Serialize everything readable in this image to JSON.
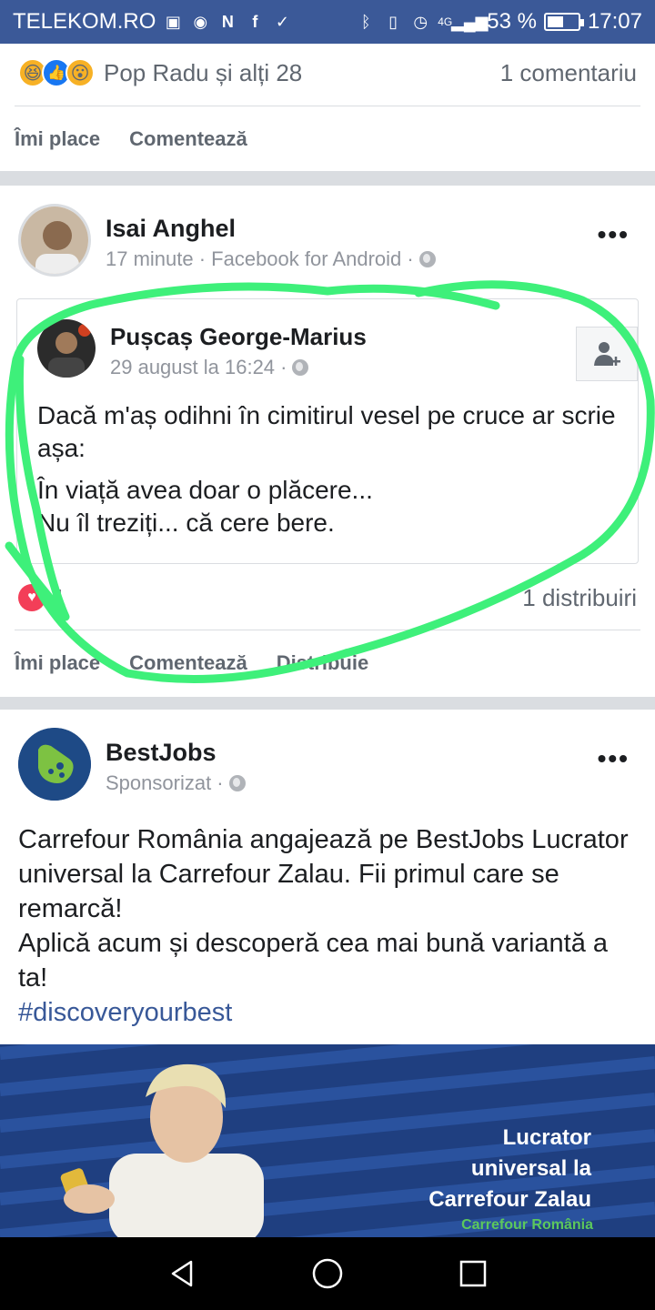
{
  "status_bar": {
    "carrier": "TELEKOM.RO",
    "network": "4G",
    "battery_text": "53 %",
    "battery_level": 0.53,
    "time": "17:07"
  },
  "post_top": {
    "reactions_text": "Pop Radu și alți 28",
    "comments_count": "1 comentariu",
    "actions": {
      "like": "Îmi place",
      "comment": "Comentează"
    }
  },
  "post_shared": {
    "author": "Isai Anghel",
    "meta": "17 minute · Facebook for Android ·",
    "original": {
      "author": "Pușcaș George-Marius",
      "meta": "29 august la 16:24 ·",
      "paragraphs": [
        "Dacă m'aș odihni în cimitirul vesel pe cruce ar scrie așa:",
        "În viață avea doar o plăcere...\nNu îl treziți... că cere bere."
      ]
    },
    "reactions_count": "1",
    "shares_count": "1 distribuiri",
    "actions": {
      "like": "Îmi place",
      "comment": "Comentează",
      "share": "Distribuie"
    }
  },
  "post_ad": {
    "author": "BestJobs",
    "meta": "Sponsorizat ·",
    "text_lines": [
      "Carrefour România angajează pe BestJobs Lucrator universal la Carrefour Zalau. Fii primul care se remarcă!",
      "Aplică acum și descoperă cea mai bună variantă a ta!"
    ],
    "hashtag": "#discoveryourbest",
    "image": {
      "title_lines": [
        "Lucrator",
        "universal la",
        "Carrefour Zalau"
      ],
      "subtitle": "Carrefour România"
    }
  },
  "colors": {
    "status_bar": "#3b5998",
    "highlight_stroke": "#3ef07a",
    "link": "#385898",
    "love": "#f33e58"
  },
  "icons": [
    "bluetooth-icon",
    "vibrate-icon",
    "alarm-icon",
    "signal-icon",
    "globe-icon",
    "more-icon",
    "add-friend-icon",
    "back-icon",
    "home-icon",
    "recents-icon"
  ]
}
